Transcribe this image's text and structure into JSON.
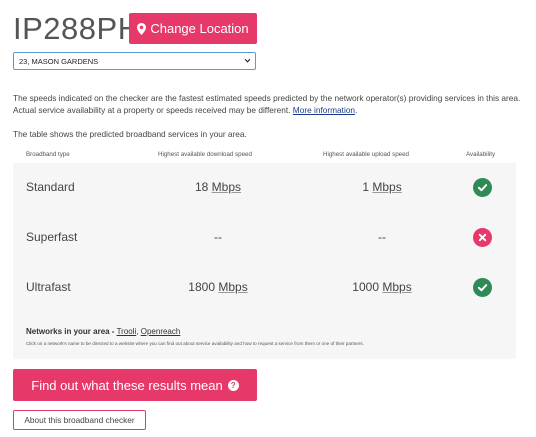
{
  "postcode": "IP288PH",
  "change_location": {
    "label": "Change Location",
    "icon": "map-marker-icon"
  },
  "address_select": {
    "value": "23, MASON GARDENS"
  },
  "intro": {
    "text": "The speeds indicated on the checker are the fastest estimated speeds predicted by the network operator(s) providing services in this area. Actual service availability at a property or speeds received may be different.",
    "link": "More information"
  },
  "table_intro": "The table shows the predicted broadband services in your area.",
  "table": {
    "headers": [
      "Broadband type",
      "Highest available download speed",
      "Highest available upload speed",
      "Availability"
    ],
    "rows": [
      {
        "type": "Standard",
        "download_value": "18",
        "download_unit": "Mbps",
        "upload_value": "1",
        "upload_unit": "Mbps",
        "available": true
      },
      {
        "type": "Superfast",
        "download_value": "--",
        "download_unit": "",
        "upload_value": "--",
        "upload_unit": "",
        "available": false
      },
      {
        "type": "Ultrafast",
        "download_value": "1800",
        "download_unit": "Mbps",
        "upload_value": "1000",
        "upload_unit": "Mbps",
        "available": true
      }
    ]
  },
  "networks": {
    "label": "Networks in your area -",
    "links": [
      "Trooli",
      "Openreach"
    ],
    "note": "Click on a network's name to be directed to a website where you can find out about service availability and how to request a service from them or one of their partners."
  },
  "results_button": {
    "label": "Find out what these results mean",
    "icon": "question-circle-icon"
  },
  "about_button": {
    "label": "About this broadband checker"
  },
  "colors": {
    "accent": "#e6396a",
    "available": "#2e8b57",
    "unavailable": "#e6396a",
    "panel": "#f6f6f6"
  }
}
